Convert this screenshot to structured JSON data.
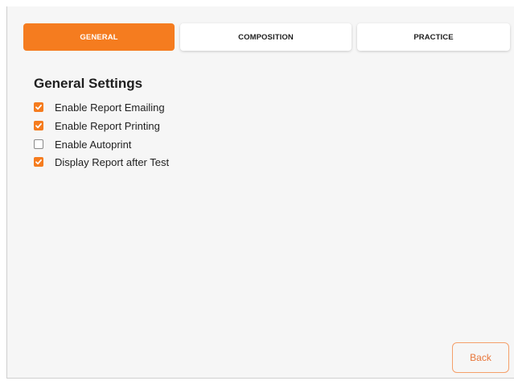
{
  "tabs": [
    {
      "label": "GENERAL",
      "active": true
    },
    {
      "label": "COMPOSITION",
      "active": false
    },
    {
      "label": "PRACTICE",
      "active": false
    }
  ],
  "general_settings": {
    "title": "General Settings",
    "options": [
      {
        "label": "Enable Report Emailing",
        "checked": true
      },
      {
        "label": "Enable Report Printing",
        "checked": true
      },
      {
        "label": "Enable Autoprint",
        "checked": false
      },
      {
        "label": "Display Report after Test",
        "checked": true
      }
    ]
  },
  "footer": {
    "back_label": "Back"
  },
  "colors": {
    "accent": "#f57c1f",
    "background": "#f6f6f6"
  },
  "icons": {
    "checked": "checkmark-icon"
  }
}
